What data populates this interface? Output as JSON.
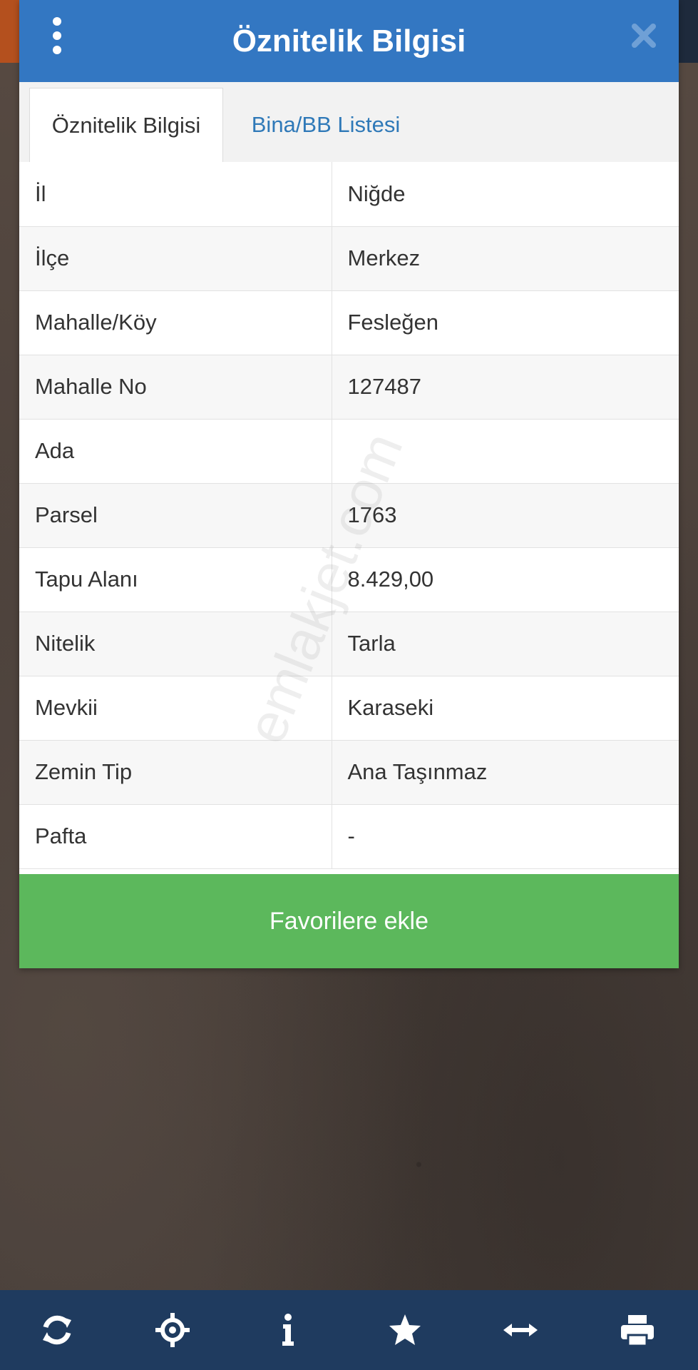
{
  "dialog": {
    "title": "Öznitelik Bilgisi"
  },
  "tabs": [
    {
      "label": "Öznitelik Bilgisi",
      "active": true
    },
    {
      "label": "Bina/BB Listesi",
      "active": false
    }
  ],
  "attributes": [
    {
      "key": "İl",
      "value": "Niğde"
    },
    {
      "key": "İlçe",
      "value": "Merkez"
    },
    {
      "key": "Mahalle/Köy",
      "value": "Fesleğen"
    },
    {
      "key": "Mahalle No",
      "value": "127487"
    },
    {
      "key": "Ada",
      "value": ""
    },
    {
      "key": "Parsel",
      "value": "1763"
    },
    {
      "key": "Tapu Alanı",
      "value": "8.429,00"
    },
    {
      "key": "Nitelik",
      "value": "Tarla"
    },
    {
      "key": "Mevkii",
      "value": "Karaseki"
    },
    {
      "key": "Zemin Tip",
      "value": "Ana Taşınmaz"
    },
    {
      "key": "Pafta",
      "value": "-"
    }
  ],
  "favorite_button": "Favorilere ekle",
  "watermark": "emlakjet.com",
  "toolbar": [
    {
      "icon": "refresh-icon"
    },
    {
      "icon": "crosshair-icon"
    },
    {
      "icon": "info-icon"
    },
    {
      "icon": "star-icon"
    },
    {
      "icon": "measure-icon"
    },
    {
      "icon": "print-icon"
    }
  ],
  "colors": {
    "header": "#3377c2",
    "button": "#5cb85c",
    "toolbar": "#1f3b5f",
    "tab_link": "#2f79b8"
  }
}
